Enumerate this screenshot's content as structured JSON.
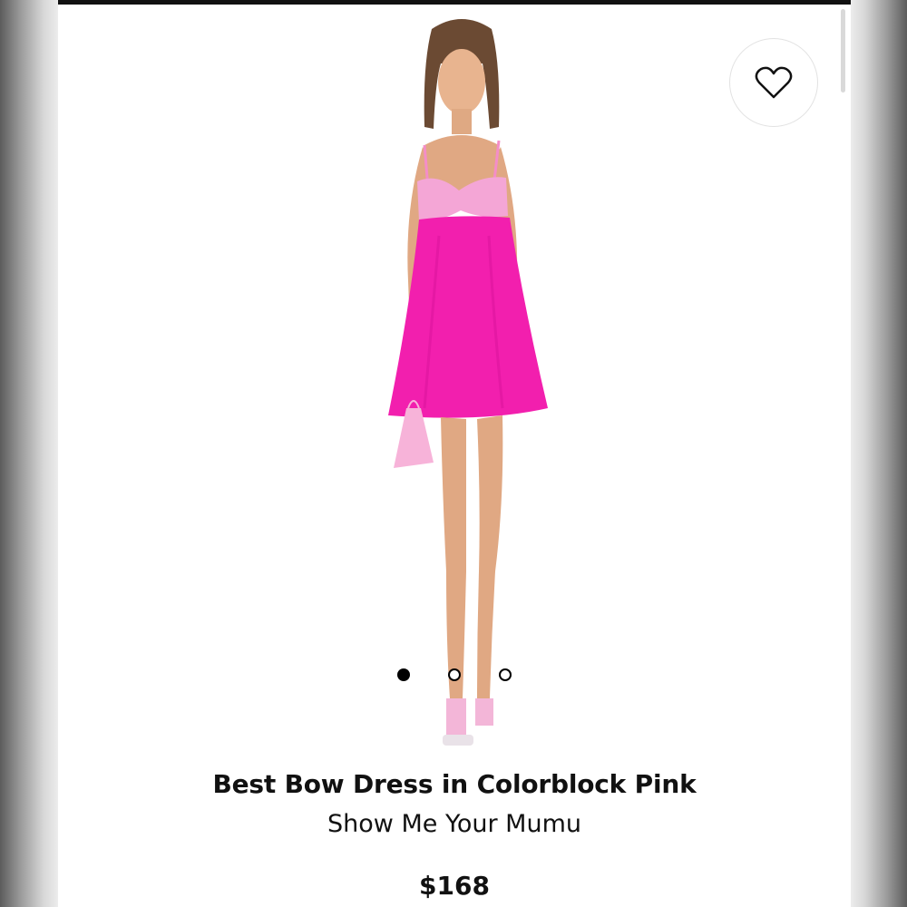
{
  "product": {
    "title": "Best Bow Dress in Colorblock Pink",
    "brand": "Show Me Your Mumu",
    "price": "$168"
  },
  "wishlist": {
    "icon": "heart-outline-icon"
  },
  "carousel": {
    "count": 3,
    "active_index": 0
  },
  "colors": {
    "dress_main": "#f21fae",
    "bow": "#f4a6d6",
    "page_bg": "#ffffff"
  }
}
